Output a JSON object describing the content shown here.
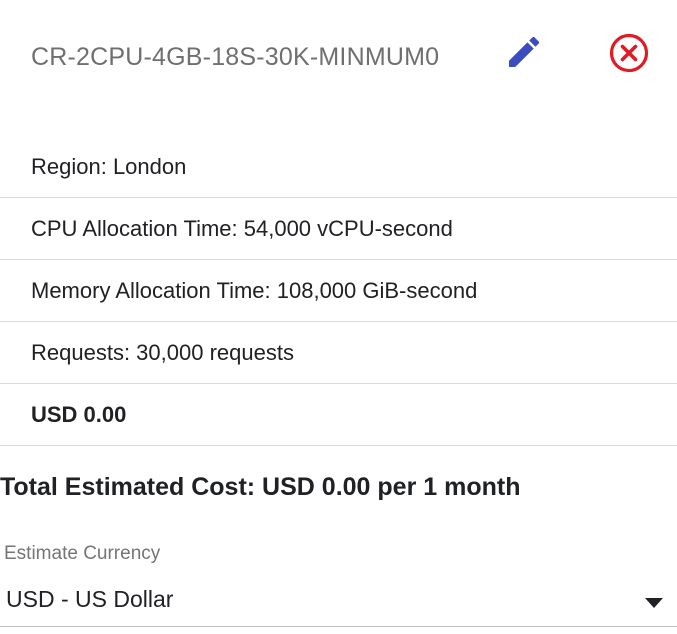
{
  "item": {
    "title": "CR-2CPU-4GB-18S-30K-MINMUM0",
    "edit_icon": "pencil-icon",
    "remove_icon": "close-circle-icon",
    "accent_color": "#3b4cc0",
    "remove_color": "#e01b24"
  },
  "details": {
    "region": "Region: London",
    "cpu": "CPU Allocation Time: 54,000 vCPU-second",
    "memory": "Memory Allocation Time: 108,000 GiB-second",
    "requests": "Requests: 30,000 requests",
    "price": "USD 0.00"
  },
  "total": {
    "label": "Total Estimated Cost: USD 0.00 per 1 month"
  },
  "currency": {
    "label": "Estimate Currency",
    "selected": "USD - US Dollar",
    "dropdown_icon": "caret-down-icon"
  }
}
